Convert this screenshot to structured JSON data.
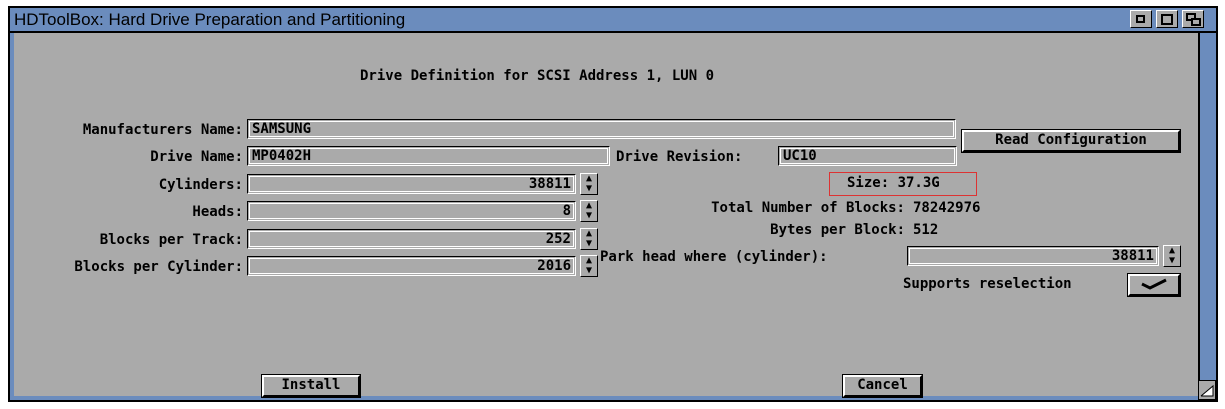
{
  "window": {
    "title": "HDToolBox: Hard Drive Preparation and Partitioning"
  },
  "heading": "Drive Definition for SCSI Address 1, LUN 0",
  "fields": {
    "manufacturer": {
      "label": "Manufacturers Name:",
      "value": "SAMSUNG"
    },
    "drive_name": {
      "label": "Drive Name:",
      "value": "MP0402H"
    },
    "drive_revision": {
      "label": "Drive Revision:",
      "value": "UC10"
    },
    "cylinders": {
      "label": "Cylinders:",
      "value": "38811"
    },
    "heads": {
      "label": "Heads:",
      "value": "8"
    },
    "blocks_per_track": {
      "label": "Blocks per Track:",
      "value": "252"
    },
    "blocks_per_cylinder": {
      "label": "Blocks per Cylinder:",
      "value": "2016"
    },
    "park_head": {
      "label": "Park head where (cylinder):",
      "value": "38811"
    }
  },
  "info": {
    "size": "Size: 37.3G",
    "total_blocks_label": "Total Number of Blocks:",
    "total_blocks_value": "78242976",
    "bytes_per_block_label": "Bytes per Block:",
    "bytes_per_block_value": "512"
  },
  "reselection": {
    "label": "Supports reselection",
    "checked": true
  },
  "buttons": {
    "read_config": "Read Configuration",
    "install": "Install",
    "cancel": "Cancel"
  },
  "colors": {
    "titlebar": "#6b8cbd",
    "background": "#aaaaaa",
    "highlight": "#dd3333"
  },
  "icons": {
    "arrow": "up-down-arrow-icon",
    "check": "checkmark-icon"
  }
}
